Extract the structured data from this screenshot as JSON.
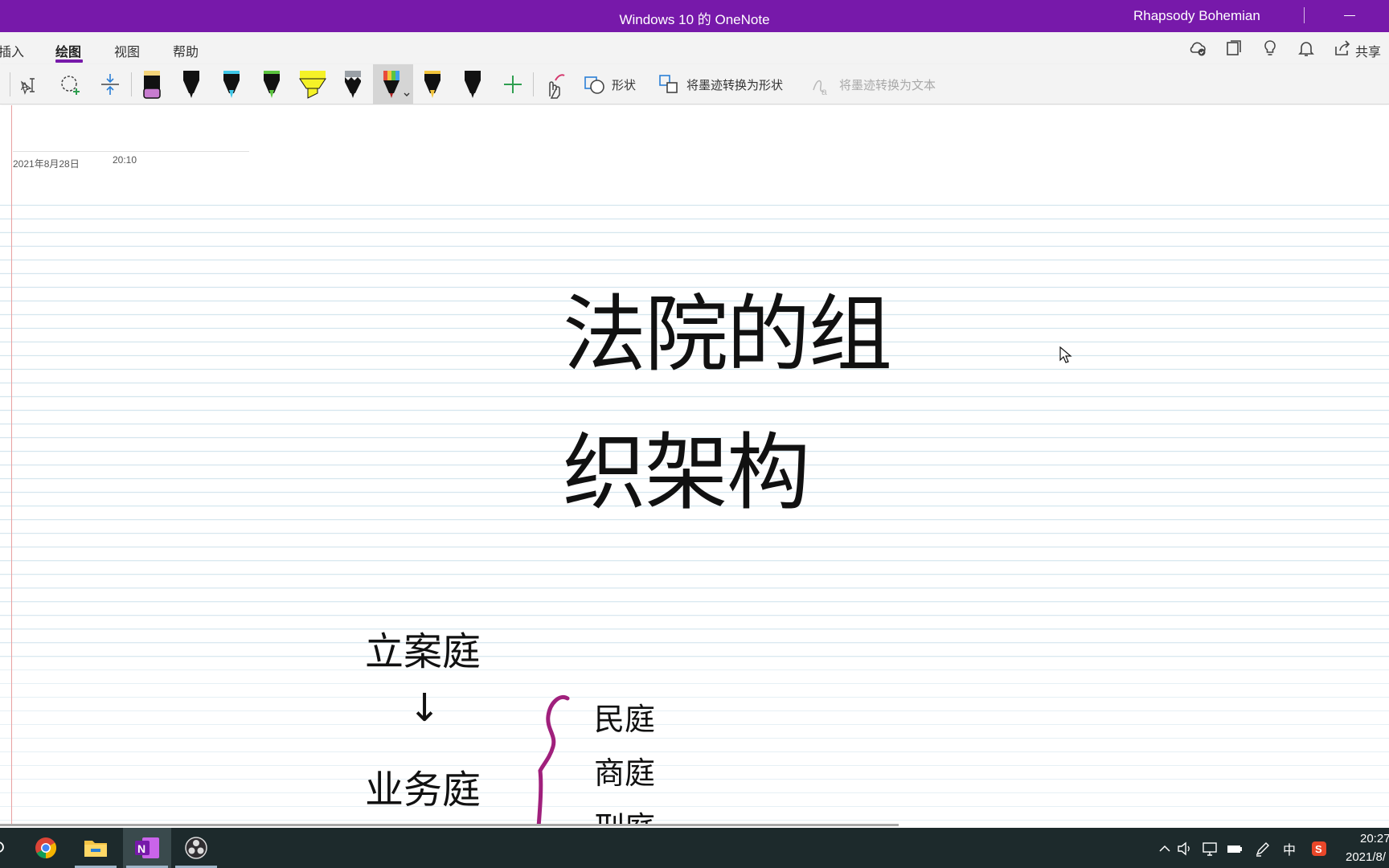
{
  "window": {
    "title": "Windows 10 的 OneNote",
    "user": "Rhapsody Bohemian"
  },
  "ribbon": {
    "tabs": [
      {
        "label": "插入"
      },
      {
        "label": "绘图",
        "active": true
      },
      {
        "label": "视图"
      },
      {
        "label": "帮助"
      }
    ],
    "right_icons": [
      "sync-status-icon",
      "pages-icon",
      "lightbulb-icon",
      "bell-icon",
      "share-icon"
    ],
    "share_label": "共享"
  },
  "toolbar": {
    "tools": [
      "type-lasso-icon",
      "lasso-select-icon",
      "insert-space-icon"
    ],
    "pens": [
      {
        "name": "eraser",
        "color": "#c77ccf"
      },
      {
        "name": "black-pen",
        "color": "#111111"
      },
      {
        "name": "cyan-pen",
        "color": "#3fc7e8"
      },
      {
        "name": "green-pen",
        "color": "#5bc43f"
      },
      {
        "name": "yellow-highlighter",
        "color": "#f5f227"
      },
      {
        "name": "galaxy-pen",
        "color": "#9aa0a6"
      },
      {
        "name": "rainbow-pen",
        "color": "#e84a3a",
        "selected": true
      },
      {
        "name": "gold-pen",
        "color": "#f2c43c"
      },
      {
        "name": "black-pen-2",
        "color": "#111111"
      }
    ],
    "add_pen": "add-pen-icon",
    "touch_draw": "touch-draw-icon",
    "shapes_label": "形状",
    "ink_to_shape_label": "将墨迹转换为形状",
    "ink_to_text_label": "将墨迹转换为文本"
  },
  "page": {
    "date": "2021年8月28日",
    "time": "20:10",
    "title_line1": "法院的组",
    "title_line2": "织架构",
    "item1": "立案庭",
    "arrow": "↓",
    "item2": "业务庭",
    "sub1": "民庭",
    "sub2": "商庭",
    "sub3": "刑庭",
    "ink_color": "#a0207c"
  },
  "taskbar": {
    "apps": [
      "chrome-icon",
      "file-explorer-icon",
      "onenote-icon",
      "obs-icon"
    ],
    "ime": "中",
    "clock_time": "20:27",
    "clock_date": "2021/8/"
  }
}
